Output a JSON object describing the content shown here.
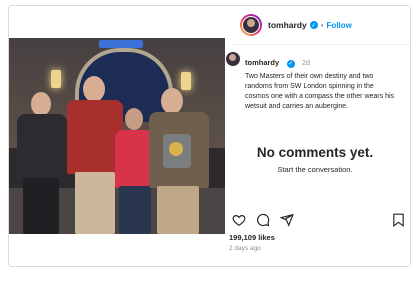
{
  "header": {
    "username": "tomhardy",
    "separator": "•",
    "follow_label": "Follow",
    "more_label": "•••"
  },
  "caption": {
    "username": "tomhardy",
    "time": "2d",
    "text": "Two Masters of their own destiny and two randoms from SW London spinning in the cosmos one with a compass the other wears his wetsuit and carries an aubergine."
  },
  "comments": {
    "empty_title": "No comments yet.",
    "empty_subtitle": "Start the conversation."
  },
  "stats": {
    "likes": "199,109 likes",
    "date": "2 days ago"
  },
  "icons": {
    "verified": "verified-badge-icon",
    "like": "heart-icon",
    "comment": "comment-icon",
    "share": "send-icon",
    "save": "bookmark-icon"
  },
  "colors": {
    "accent": "#0095f6",
    "text": "#262626",
    "muted": "#8e8e8e",
    "border": "#dbdbdb"
  }
}
